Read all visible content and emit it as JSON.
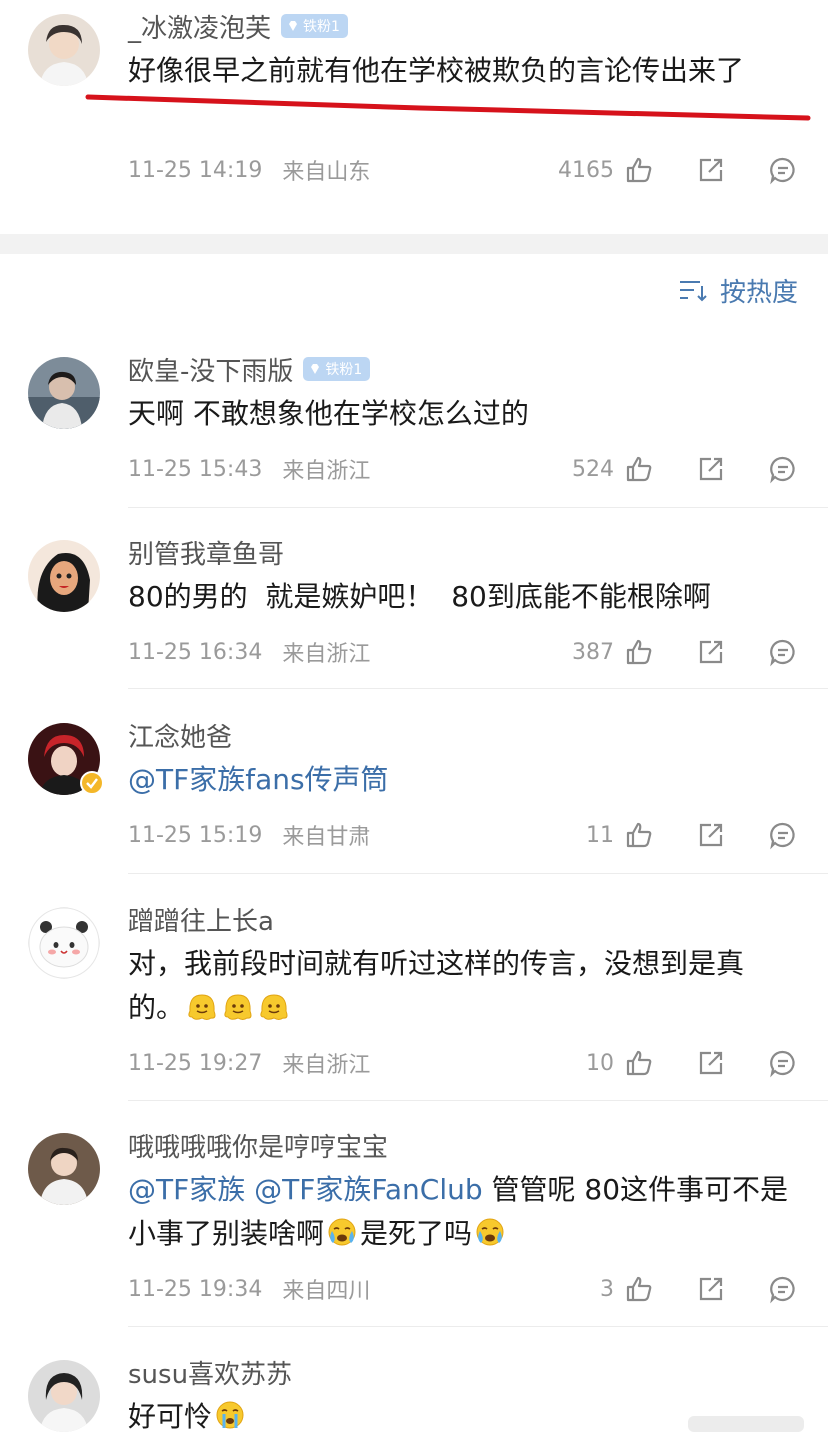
{
  "sort": {
    "label": "按热度"
  },
  "comments": [
    {
      "username": "_冰激凌泡芙",
      "badge": "铁粉1",
      "text": "好像很早之前就有他在学校被欺负的言论传出来了",
      "time": "11-25 14:19",
      "location": "来自山东",
      "likes": "4165"
    },
    {
      "username": "欧皇-没下雨版",
      "badge": "铁粉1",
      "text": "天啊 不敢想象他在学校怎么过的",
      "time": "11-25 15:43",
      "location": "来自浙江",
      "likes": "524"
    },
    {
      "username": "别管我章鱼哥",
      "text": "80的男的  就是嫉妒吧！  80到底能不能根除啊",
      "time": "11-25 16:34",
      "location": "来自浙江",
      "likes": "387"
    },
    {
      "username": "江念她爸",
      "mention": "@TF家族fans传声筒",
      "time": "11-25 15:19",
      "location": "来自甘肃",
      "likes": "11"
    },
    {
      "username": "蹭蹭往上长a",
      "text": "对，我前段时间就有听过这样的传言，没想到是真的。",
      "time": "11-25 19:27",
      "location": "来自浙江",
      "likes": "10"
    },
    {
      "username": "哦哦哦哦你是哼哼宝宝",
      "mention1": "@TF家族",
      "mention2": "@TF家族FanClub",
      "text_a": "管管呢 80这件事可不是小事了别装啥啊",
      "text_b": "是死了吗",
      "time": "11-25 19:34",
      "location": "来自四川",
      "likes": "3"
    },
    {
      "username": "susu喜欢苏苏",
      "text": "好可怜"
    }
  ],
  "icons": {
    "like": "thumbs-up-icon",
    "share": "share-icon",
    "reply": "comment-icon",
    "sort": "sort-icon",
    "badge": "diamond-icon",
    "verified": "verified-icon"
  },
  "colors": {
    "accent": "#3b6ea8",
    "badge": "#bcd6f3",
    "annotation": "#d6121b"
  }
}
